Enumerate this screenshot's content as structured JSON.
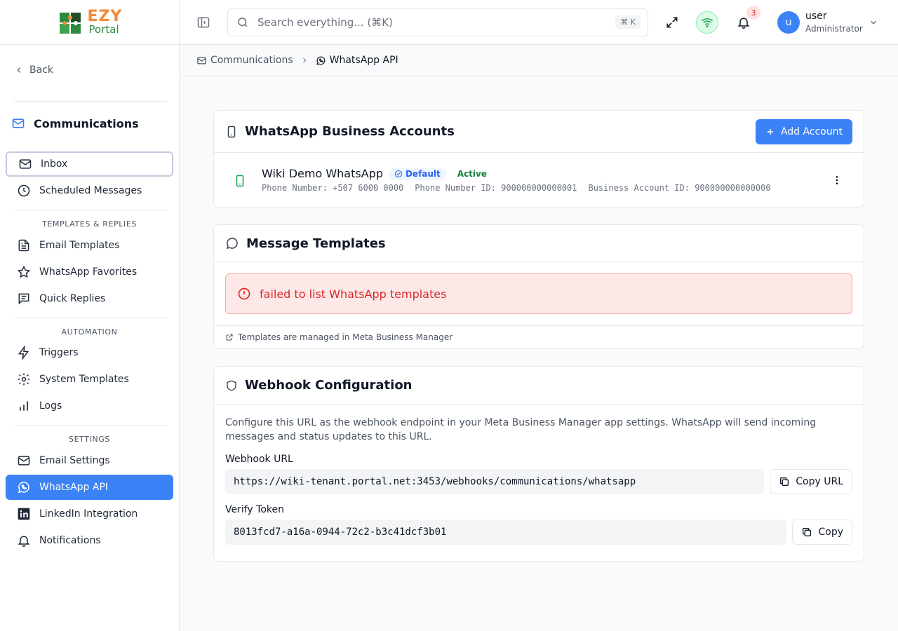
{
  "brand": {
    "line1": "EZY",
    "line2": "Portal"
  },
  "sidebar": {
    "back_label": "Back",
    "section_title": "Communications",
    "items": [
      {
        "label": "Inbox"
      },
      {
        "label": "Scheduled Messages"
      },
      {
        "label": "Email Templates"
      },
      {
        "label": "WhatsApp Favorites"
      },
      {
        "label": "Quick Replies"
      },
      {
        "label": "Triggers"
      },
      {
        "label": "System Templates"
      },
      {
        "label": "Logs"
      },
      {
        "label": "Email Settings"
      },
      {
        "label": "WhatsApp API"
      },
      {
        "label": "LinkedIn Integration"
      },
      {
        "label": "Notifications"
      }
    ],
    "groups": [
      "TEMPLATES & REPLIES",
      "AUTOMATION",
      "SETTINGS"
    ]
  },
  "header": {
    "search_placeholder": "Search everything... (⌘K)",
    "search_shortcut": "⌘ K",
    "notification_count": "3",
    "user_initial": "u",
    "user_name": "user",
    "user_role": "Administrator"
  },
  "breadcrumb": {
    "parent": "Communications",
    "current": "WhatsApp API"
  },
  "accounts_card": {
    "title": "WhatsApp Business Accounts",
    "add_button": "Add Account",
    "account": {
      "name": "Wiki Demo WhatsApp",
      "default_badge": "Default",
      "status": "Active",
      "phone_number": "Phone Number: +507 6000 0000",
      "phone_number_id": "Phone Number ID: 900000000000001",
      "business_account_id": "Business Account ID: 900000000000000"
    }
  },
  "templates_card": {
    "title": "Message Templates",
    "error": "failed to list WhatsApp templates",
    "footer": "Templates are managed in Meta Business Manager"
  },
  "webhook_card": {
    "title": "Webhook Configuration",
    "description": "Configure this URL as the webhook endpoint in your Meta Business Manager app settings. WhatsApp will send incoming messages and status updates to this URL.",
    "url_label": "Webhook URL",
    "url_value": "https://wiki-tenant.portal.net:3453/webhooks/communications/whatsapp",
    "copy_url_button": "Copy URL",
    "token_label": "Verify Token",
    "token_value": "8013fcd7-a16a-0944-72c2-b3c41dcf3b01",
    "copy_button": "Copy"
  },
  "colors": {
    "accent": "#3b82f6",
    "error": "#dc2626",
    "success": "#15803d",
    "brand_orange": "#f08a3c",
    "brand_green": "#2e8b3e"
  }
}
